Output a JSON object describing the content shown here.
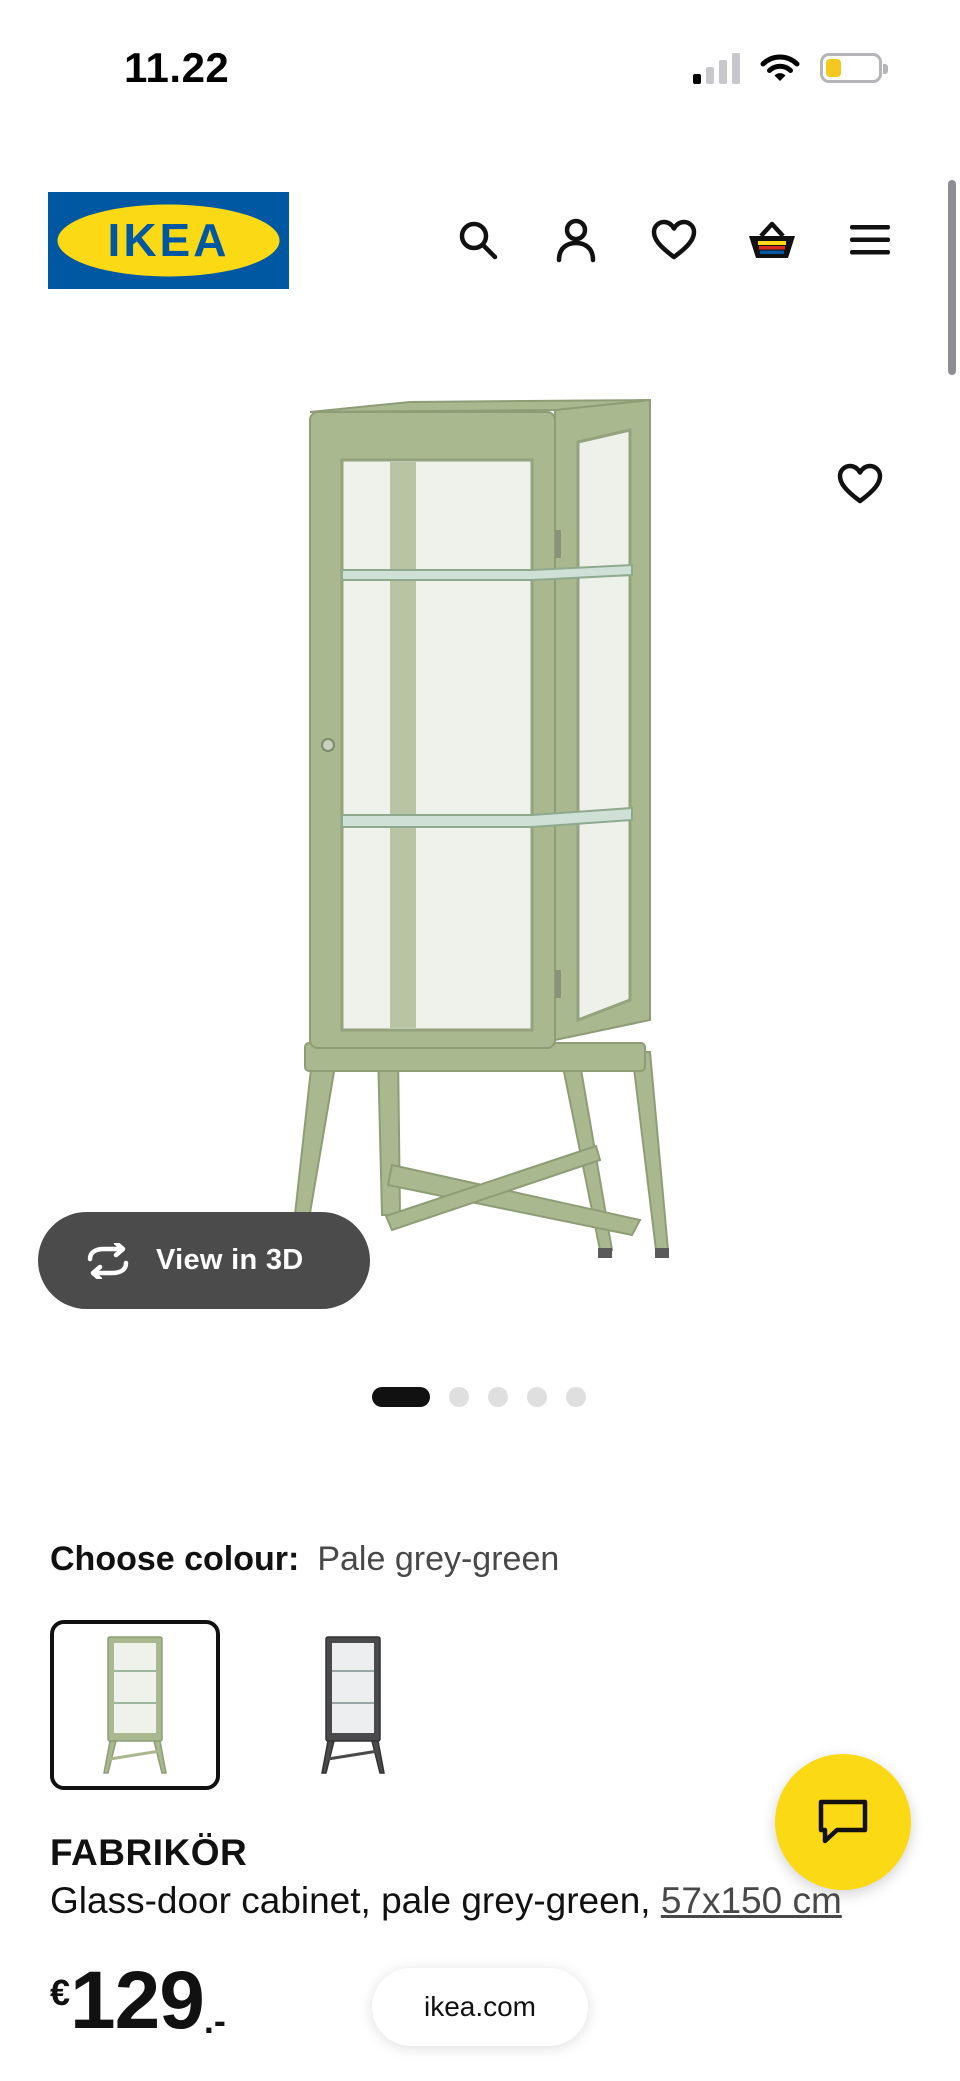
{
  "status_bar": {
    "time": "11.22",
    "battery_level": 0.3
  },
  "header": {
    "logo_text": "IKEA",
    "icons": [
      "search-icon",
      "user-icon",
      "heart-icon",
      "basket-icon",
      "menu-icon"
    ]
  },
  "gallery": {
    "view_3d_label": "View in 3D",
    "image_count": 5,
    "active_index": 0
  },
  "colour": {
    "label": "Choose colour:",
    "value": "Pale grey-green",
    "options": [
      "pale-grey-green",
      "dark-grey"
    ],
    "selected_index": 0
  },
  "product": {
    "name": "FABRIKÖR",
    "description": "Glass-door cabinet, pale grey-green, ",
    "size": "57x150 cm"
  },
  "price": {
    "currency": "€",
    "amount": "129",
    "suffix": ".-"
  },
  "browser": {
    "url": "ikea.com"
  },
  "colors": {
    "ikea_blue": "#0058a3",
    "ikea_yellow": "#fbd914",
    "cabinet_green": "#a9b88f",
    "dark_pill": "#4b4b4b"
  }
}
